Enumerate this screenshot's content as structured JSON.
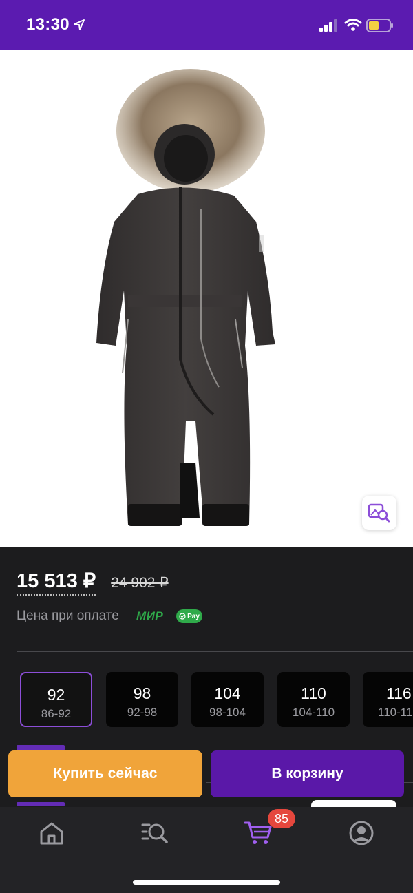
{
  "status_bar": {
    "time": "13:30",
    "background": "#5b1bb0",
    "icons": [
      "location-arrow-icon",
      "signal-icon",
      "wifi-icon",
      "battery-icon"
    ]
  },
  "product": {
    "image_alt": "child winter snowsuit with fur hood",
    "header_icons": [
      "back-chevron-icon",
      "heart-icon",
      "share-icon",
      "visual-search-icon"
    ]
  },
  "price": {
    "current": "15 513 ₽",
    "old": "24 902 ₽",
    "note": "Цена при оплате",
    "mir_logo": "МИР",
    "pay_badge": "Pay"
  },
  "sizes": [
    {
      "size": "92",
      "range": "86-92",
      "selected": true
    },
    {
      "size": "98",
      "range": "92-98",
      "selected": false
    },
    {
      "size": "104",
      "range": "98-104",
      "selected": false
    },
    {
      "size": "110",
      "range": "104-110",
      "selected": false
    },
    {
      "size": "116",
      "range": "110-116",
      "selected": false
    }
  ],
  "actions": {
    "buy_now": "Купить сейчас",
    "add_to_cart": "В корзину",
    "buy_color": "#f0a43a",
    "cart_color": "#5a18a8"
  },
  "tab_bar": {
    "items": [
      "home-icon",
      "catalog-search-icon",
      "cart-icon",
      "profile-icon"
    ],
    "cart_badge": "85",
    "active": "cart-icon",
    "active_color": "#a05ff0"
  }
}
